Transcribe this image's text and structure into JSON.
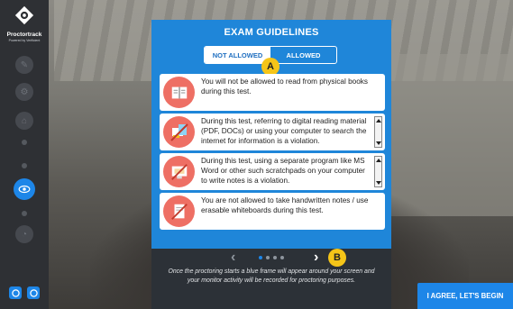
{
  "app": {
    "brand": "Proctortrack",
    "tagline": "Powered by Verificient"
  },
  "modal": {
    "title": "EXAM GUIDELINES",
    "tabs": [
      {
        "label": "NOT ALLOWED",
        "active": true
      },
      {
        "label": "ALLOWED",
        "active": false
      }
    ],
    "cards": [
      {
        "icon": "book-icon",
        "text": "You will not be allowed to read from physical books during this test."
      },
      {
        "icon": "digital-material-icon",
        "text": "During this test, referring to digital reading material (PDF, DOCs) or using your computer to search the internet for information is a violation."
      },
      {
        "icon": "notes-program-icon",
        "text": "During this test, using a separate program like MS Word or other such scratchpads on your computer to write notes is a violation."
      },
      {
        "icon": "handwritten-notes-icon",
        "text": "You are not allowed to take handwritten notes / use erasable whiteboards during this test."
      }
    ],
    "pager": {
      "prev": "‹",
      "next": "›",
      "pages": 4,
      "current": 1
    },
    "note": "Once the proctoring starts a blue frame will appear around your screen and your monitor activity will be recorded for proctoring purposes."
  },
  "markers": {
    "a": "A",
    "b": "B"
  },
  "agree_button": "I AGREE, LET'S BEGIN",
  "colors": {
    "accent": "#1d86e8",
    "danger": "#ee6f64",
    "marker": "#f5c518"
  }
}
